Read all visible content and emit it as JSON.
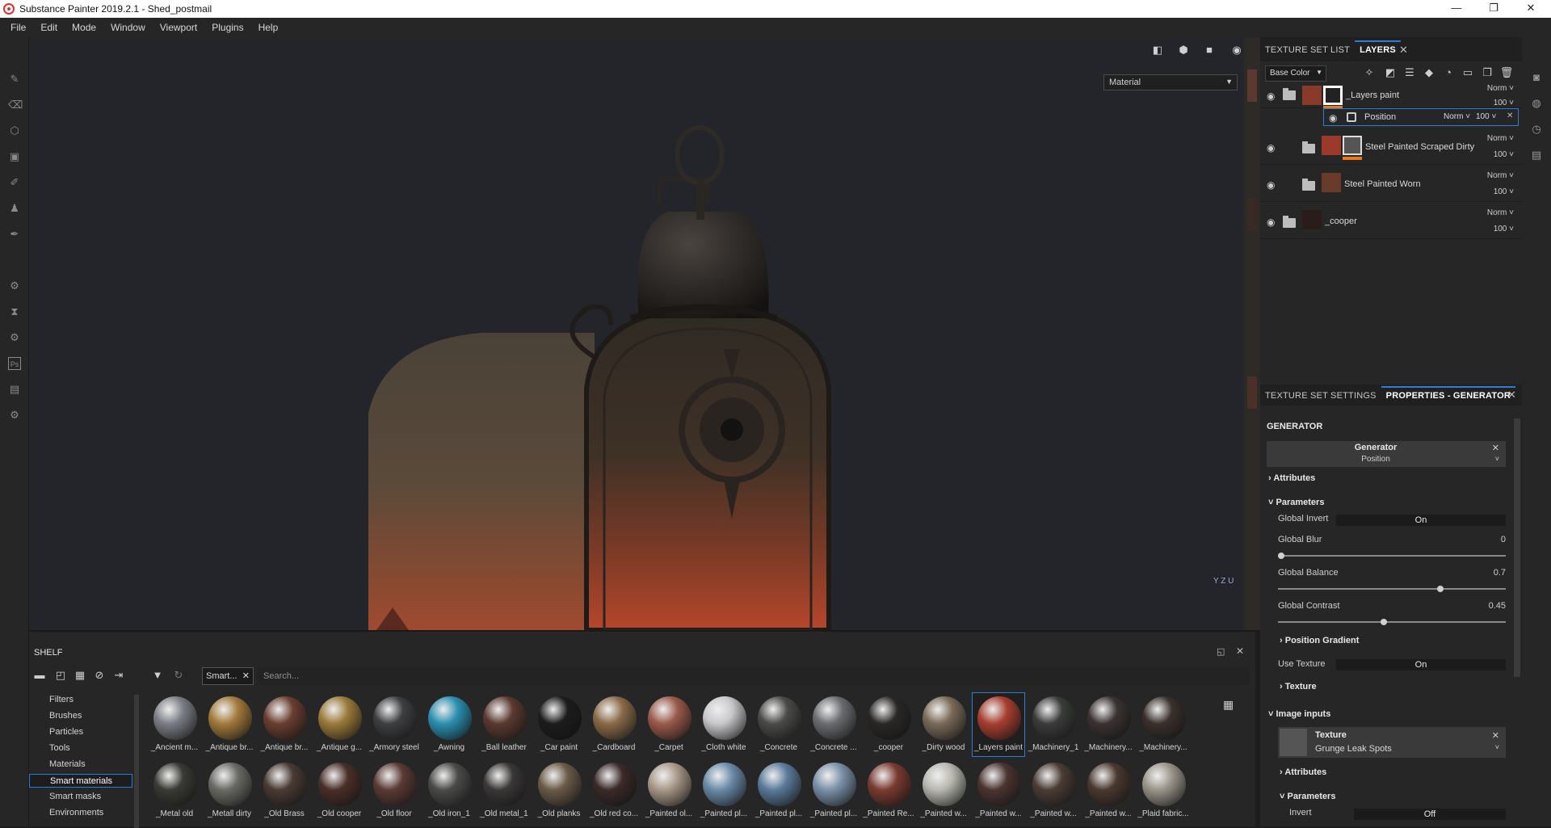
{
  "window": {
    "title": "Substance Painter 2019.2.1 - Shed_postmail",
    "minimize": "—",
    "maximize": "❐",
    "close": "✕"
  },
  "menu": [
    "File",
    "Edit",
    "Mode",
    "Window",
    "Viewport",
    "Plugins",
    "Help"
  ],
  "viewport": {
    "material_select": "Material",
    "axis_y": "Y",
    "axis_z": "Z",
    "axis_u": "U"
  },
  "layers_panel": {
    "tabs": [
      "TEXTURE SET LIST",
      "LAYERS"
    ],
    "channel_select": "Base Color",
    "layers": [
      {
        "name": "_Layers paint",
        "blend": "Norm",
        "opacity": "100"
      },
      {
        "name": "Position",
        "blend": "Norm",
        "opacity": "100"
      },
      {
        "name": "Steel Painted Scraped Dirty",
        "blend": "Norm",
        "opacity": "100"
      },
      {
        "name": "Steel Painted Worn",
        "blend": "Norm",
        "opacity": "100"
      },
      {
        "name": "_cooper",
        "blend": "Norm",
        "opacity": "100"
      }
    ]
  },
  "props_panel": {
    "tabs": [
      "TEXTURE SET SETTINGS",
      "PROPERTIES - GENERATOR"
    ],
    "section": "GENERATOR",
    "generator_title": "Generator",
    "generator_value": "Position",
    "attributes": "Attributes",
    "parameters": "Parameters",
    "global_invert": {
      "label": "Global Invert",
      "value": "On"
    },
    "global_blur": {
      "label": "Global Blur",
      "value": "0",
      "fraction": 0.0
    },
    "global_balance": {
      "label": "Global Balance",
      "value": "0.7",
      "fraction": 0.7
    },
    "global_contrast": {
      "label": "Global Contrast",
      "value": "0.45",
      "fraction": 0.45
    },
    "position_gradient": "Position Gradient",
    "use_texture": {
      "label": "Use Texture",
      "value": "On"
    },
    "texture": "Texture",
    "image_inputs": "Image inputs",
    "img_texture_title": "Texture",
    "img_texture_value": "Grunge Leak Spots",
    "attributes2": "Attributes",
    "parameters2": "Parameters",
    "invert": {
      "label": "Invert",
      "value": "Off"
    }
  },
  "shelf": {
    "title": "SHELF",
    "filter_tag": "Smart...",
    "search_placeholder": "Search...",
    "categories": [
      "Filters",
      "Brushes",
      "Particles",
      "Tools",
      "Materials",
      "Smart materials",
      "Smart masks",
      "Environments"
    ],
    "selected_category": "Smart materials",
    "items_row1": [
      "_Ancient m...",
      "_Antique br...",
      "_Antique br...",
      "_Antique g...",
      "_Armory steel",
      "_Awning",
      "_Ball leather",
      "_Car paint",
      "_Cardboard",
      "_Carpet",
      "_Cloth white",
      "_Concrete",
      "_Concrete ...",
      "_cooper",
      "_Dirty wood",
      "_Layers paint",
      "_Machinery_1",
      "_Machinery...",
      "_Machinery..."
    ],
    "items_row2": [
      "_Metal old",
      "_Metall dirty",
      "_Old Brass",
      "_Old cooper",
      "_Old floor",
      "_Old iron_1",
      "_Old metal_1",
      "_Old planks",
      "_Old red co...",
      "_Painted ol...",
      "_Painted pl...",
      "_Painted pl...",
      "_Painted pl...",
      "_Painted Re...",
      "_Painted w...",
      "_Painted w...",
      "_Painted w...",
      "_Painted w...",
      "_Plaid fabric..."
    ],
    "selected_item": "_Layers paint"
  },
  "colors": {
    "accent": "#2c7ed4",
    "orange": "#e87a1d"
  }
}
